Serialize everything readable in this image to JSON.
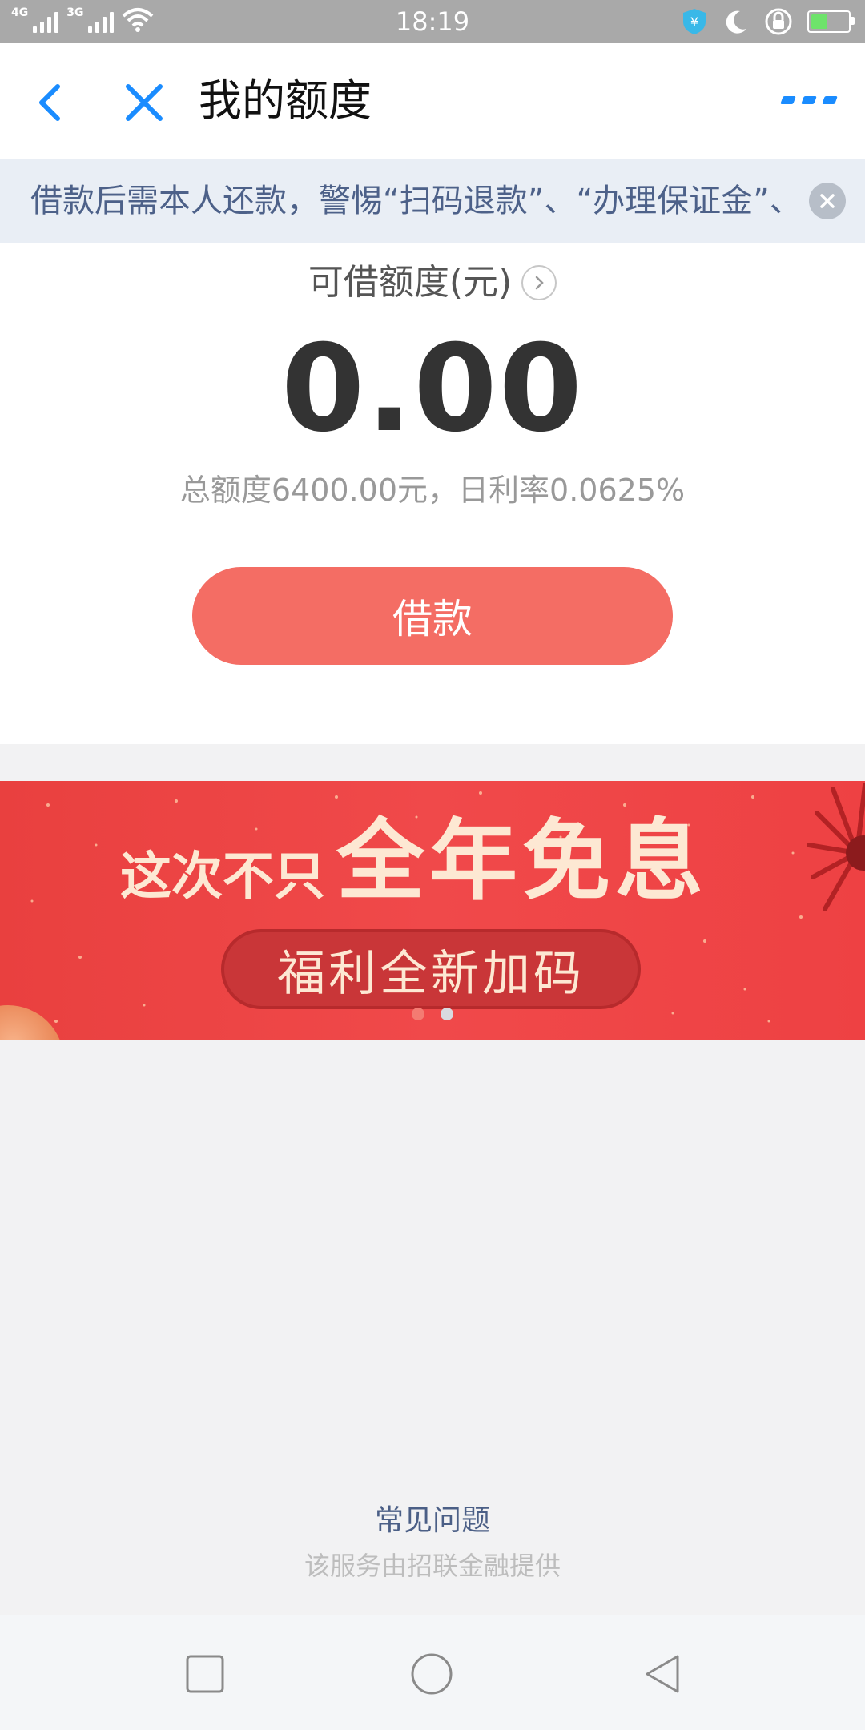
{
  "status_bar": {
    "time": "18:19",
    "sim1": "4G",
    "sim2": "3G",
    "battery_level": 0.4
  },
  "title_bar": {
    "title": "我的额度"
  },
  "notice": {
    "text": "借款后需本人还款，警惕“扫码退款”、“办理保证金”、"
  },
  "quota": {
    "label": "可借额度(元)",
    "amount": "0.00",
    "summary": "总额度6400.00元，日利率0.0625%",
    "borrow_button": "借款"
  },
  "banner": {
    "line_small": "这次不只",
    "line_big": "全年免息",
    "pill_text": "福利全新加码",
    "active_slide": 0,
    "slide_count": 2
  },
  "footer": {
    "faq": "常见问题",
    "provider": "该服务由招联金融提供"
  },
  "colors": {
    "accent": "#1a8cff",
    "button": "#f46d64",
    "banner": "#ee4143",
    "notice_text": "#4d6189"
  }
}
